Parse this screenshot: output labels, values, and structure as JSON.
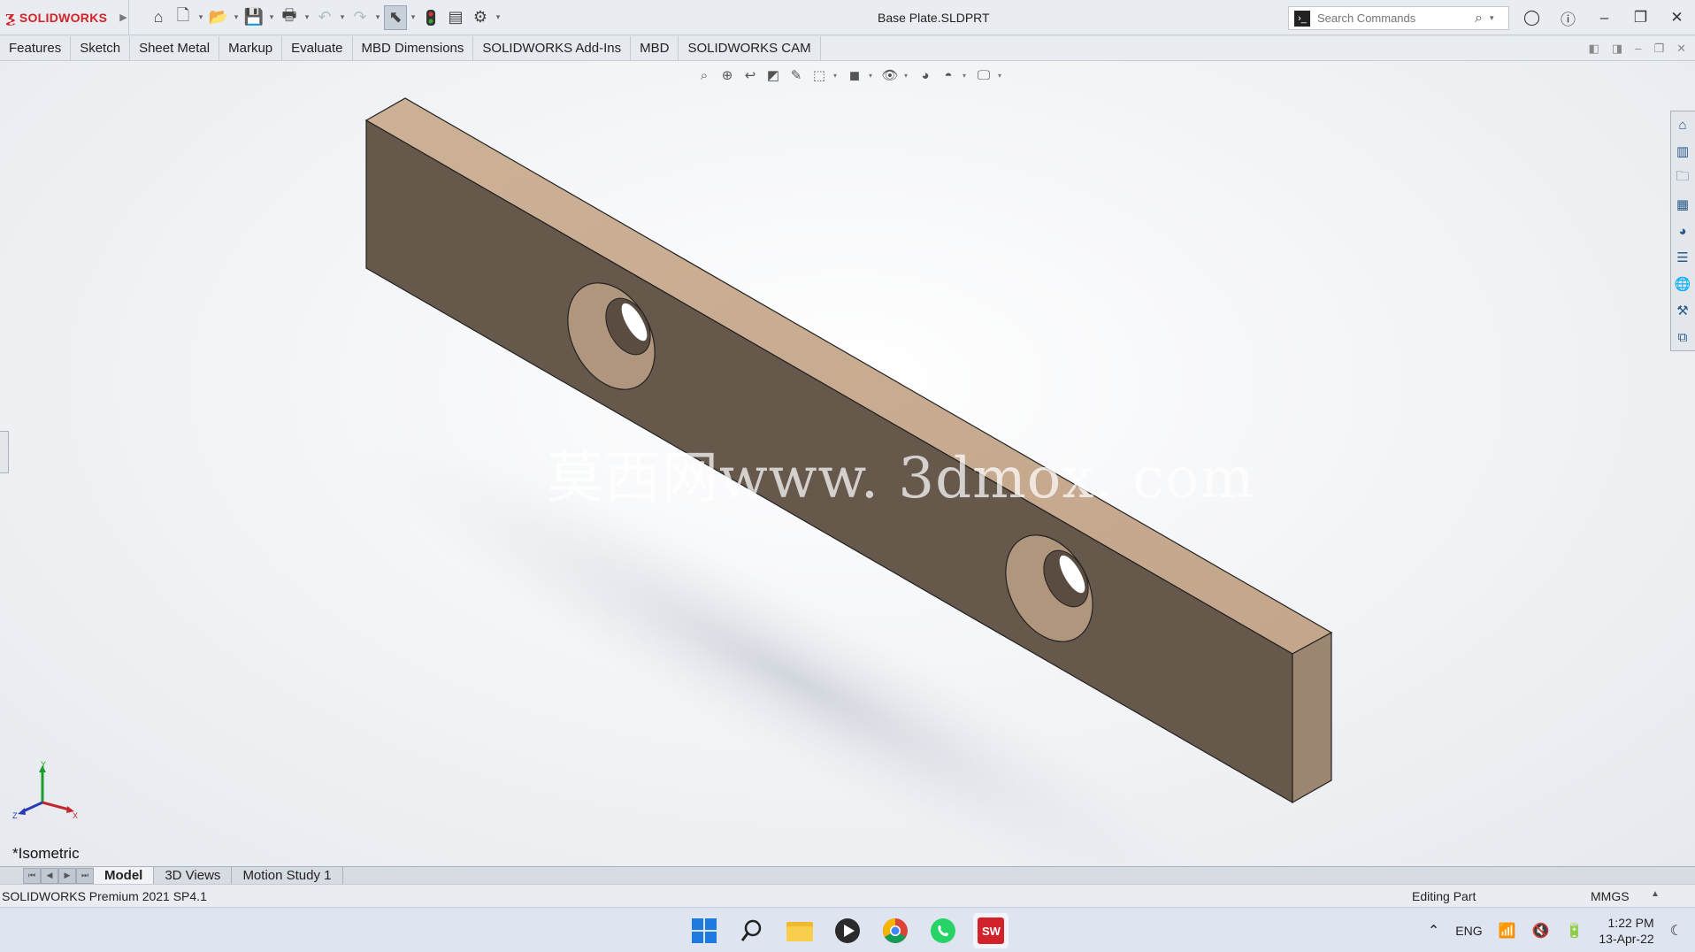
{
  "app": {
    "brand": "SOLIDWORKS",
    "document_title": "Base Plate.SLDPRT"
  },
  "search": {
    "placeholder": "Search Commands"
  },
  "quick_access": [
    {
      "name": "home-icon"
    },
    {
      "name": "new-document-icon"
    },
    {
      "name": "open-icon"
    },
    {
      "name": "save-icon"
    },
    {
      "name": "print-icon"
    },
    {
      "name": "undo-icon"
    },
    {
      "name": "redo-icon"
    },
    {
      "name": "select-pointer-icon"
    },
    {
      "name": "rebuild-icon"
    },
    {
      "name": "file-properties-icon"
    },
    {
      "name": "options-gear-icon"
    }
  ],
  "command_tabs": [
    "Features",
    "Sketch",
    "Sheet Metal",
    "Markup",
    "Evaluate",
    "MBD Dimensions",
    "SOLIDWORKS Add-Ins",
    "MBD",
    "SOLIDWORKS CAM"
  ],
  "viewport": {
    "watermark": "莫西网www. 3dmox. com",
    "view_orientation": "*Isometric",
    "model_colors": {
      "front_face": "#66584b",
      "top_face": "#c6a98e",
      "end_face": "#9c8571",
      "hole_wall": "#b0967d",
      "hole_shadow": "#5a4c40"
    },
    "triad_labels": {
      "x": "X",
      "y": "Y",
      "z": "Z"
    }
  },
  "bottom_tabs": [
    "Model",
    "3D Views",
    "Motion Study 1"
  ],
  "status": {
    "version": "SOLIDWORKS Premium 2021 SP4.1",
    "mode": "Editing Part",
    "units": "MMGS"
  },
  "taskbar": {
    "language": "ENG",
    "time": "1:22 PM",
    "date": "13-Apr-22"
  }
}
